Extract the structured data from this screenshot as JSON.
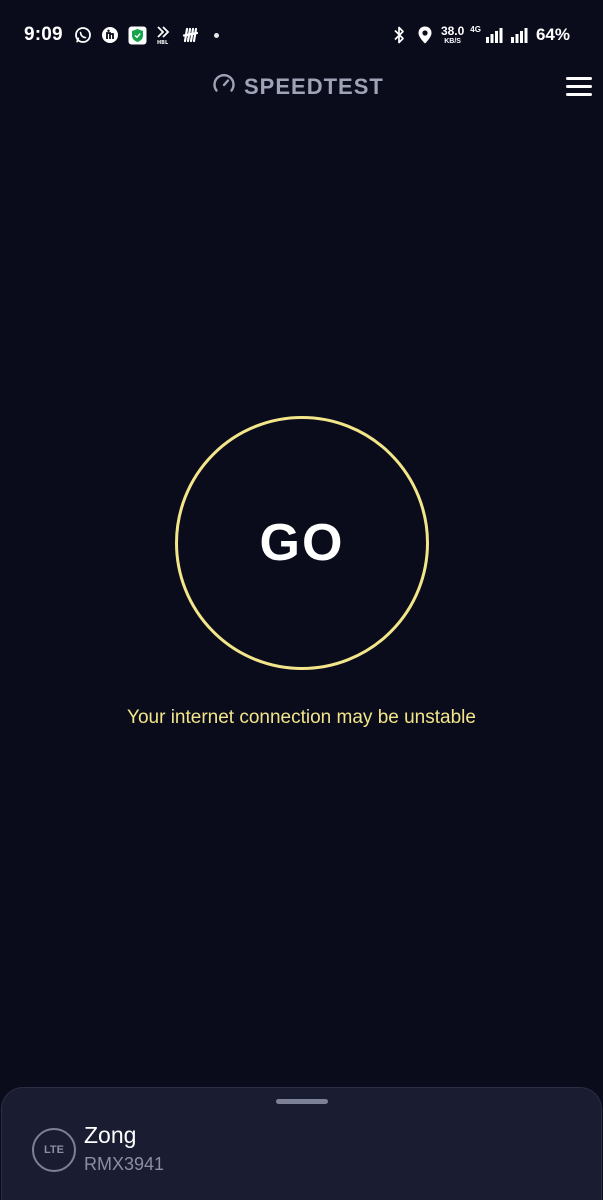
{
  "status_bar": {
    "time": "9:09",
    "left_icons": [
      "whatsapp-icon",
      "app-badge-icon",
      "shield-icon",
      "hbl-icon",
      "app-h-icon"
    ],
    "net_speed_value": "38.0",
    "net_speed_unit": "KB/S",
    "network_type": "4G",
    "battery": "64%"
  },
  "header": {
    "title": "SPEEDTEST",
    "logo_icon": "speedometer-icon",
    "menu_icon": "hamburger-menu-icon"
  },
  "main": {
    "go_label": "GO",
    "warning": "Your internet connection may be unstable"
  },
  "connection": {
    "badge": "LTE",
    "provider": "Zong",
    "device": "RMX3941"
  },
  "colors": {
    "background": "#0a0c1b",
    "accent": "#f2e58a",
    "sheet": "#1a1d31",
    "muted": "#8a8ea3"
  }
}
